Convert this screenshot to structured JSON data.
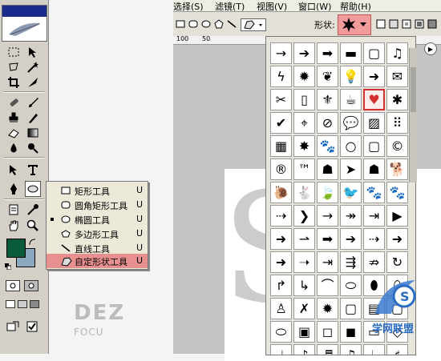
{
  "menubar": {
    "items": [
      "选择(S)",
      "滤镜(T)",
      "视图(V)",
      "窗口(W)",
      "帮助(H)"
    ]
  },
  "options": {
    "shape_label": "形状:"
  },
  "ruler": {
    "labels": [
      "100",
      "50"
    ]
  },
  "flyout": {
    "items": [
      {
        "label": "矩形工具",
        "key": "U",
        "icon": "rectangle-icon"
      },
      {
        "label": "圆角矩形工具",
        "key": "U",
        "icon": "rounded-rectangle-icon"
      },
      {
        "label": "椭圆工具",
        "key": "U",
        "icon": "ellipse-icon"
      },
      {
        "label": "多边形工具",
        "key": "U",
        "icon": "polygon-icon"
      },
      {
        "label": "直线工具",
        "key": "U",
        "icon": "line-icon"
      },
      {
        "label": "自定形状工具",
        "key": "U",
        "icon": "custom-shape-icon"
      }
    ],
    "active_index": 2,
    "selected_index": 5
  },
  "colors": {
    "foreground": "#0a5a3c",
    "background": "#8aa8c0",
    "selection": "#e89090",
    "shape_selected": "#d43030"
  },
  "shapes": [
    "→",
    "➔",
    "➡",
    "▬",
    "▢",
    "♫",
    "ϟ",
    "✹",
    "❦",
    "💡",
    "➜",
    "✉",
    "✂",
    "▯",
    "⚜",
    "☕",
    "♥",
    "✱",
    "✔",
    "⌖",
    "⊘",
    "💬",
    "▨",
    "⠿",
    "▦",
    "✸",
    "🐾",
    "○",
    "▢",
    "©",
    "®",
    "™",
    "☗",
    "➤",
    "☗",
    "🐕",
    "🐌",
    "🐇",
    "🍃",
    "🐦",
    "🐾",
    "🐾",
    "⇢",
    "❯",
    "→",
    "↠",
    "⇥",
    "▶",
    "➜",
    "⇀",
    "➡",
    "➔",
    "⇢",
    "➜",
    "➜",
    "➝",
    "⇥",
    "⇶",
    "⇏",
    "↻",
    "↱",
    "↳",
    "⌒",
    "⬭",
    "⬮",
    "⬯",
    "♙",
    "✗",
    "✹",
    "▢",
    "▤",
    "▢",
    "⬭",
    "▣",
    "◻",
    "◼",
    "▭",
    "◇",
    "♩",
    "♪",
    "♬",
    "♫",
    "♭",
    "♯"
  ],
  "shape_selected_index": 16,
  "watermark": {
    "line1": "DEZ",
    "line2": "FOCU"
  },
  "brand": {
    "text": "学网联盟"
  }
}
